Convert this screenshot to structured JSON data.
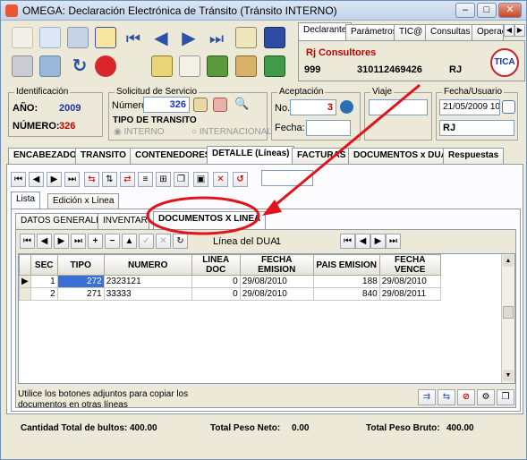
{
  "window": {
    "title": "OMEGA: Declaración Electrónica de Tránsito  (Tránsito INTERNO)"
  },
  "top_tabs": [
    "Declarante",
    "Parámetros",
    "TIC@",
    "Consultas",
    "Operac"
  ],
  "declarante": {
    "name": "Rj Consultores",
    "code": "999",
    "nit": "310112469426",
    "initials": "RJ"
  },
  "identificacion": {
    "label": "Identificación",
    "anio_label": "AÑO:",
    "anio": "2009",
    "numero_label": "NÚMERO:",
    "numero": "326"
  },
  "solicitud": {
    "label": "Solicitud de Servicio",
    "numero_label": "Número:",
    "numero": "326"
  },
  "tipo_transito": {
    "label": "TIPO DE TRANSITO",
    "interno": "INTERNO",
    "internacional": "INTERNACIONAL"
  },
  "aceptacion": {
    "label": "Aceptación",
    "no_label": "No.",
    "no": "3",
    "fecha_label": "Fecha:"
  },
  "viaje": {
    "label": "Viaje"
  },
  "fecha_usuario": {
    "label": "Fecha/Usuario",
    "fecha": "21/05/2009 10:",
    "usuario": "RJ"
  },
  "main_tabs": [
    "ENCABEZADO",
    "TRANSITO",
    "CONTENEDORES",
    "DETALLE (Líneas)",
    "FACTURAS",
    "DOCUMENTOS x DUA",
    "Respuestas"
  ],
  "sub_tabs": [
    "Lista",
    "Edición x Línea"
  ],
  "detail_tabs": [
    "DATOS GENERALES",
    "INVENTARIO",
    "DOCUMENTOS X LINEA"
  ],
  "linea_dua": {
    "label": "Línea del DUA:",
    "value": "1"
  },
  "grid": {
    "columns": [
      "SEC",
      "TIPO",
      "NUMERO",
      "LINEA DOC",
      "FECHA EMISION",
      "PAIS EMISION",
      "FECHA VENCE"
    ],
    "rows": [
      {
        "sec": "1",
        "tipo": "272",
        "numero": "2323121",
        "linea_doc": "0",
        "fecha_emision": "29/08/2010",
        "pais_emision": "188",
        "fecha_vence": "29/08/2010"
      },
      {
        "sec": "2",
        "tipo": "271",
        "numero": "33333",
        "linea_doc": "0",
        "fecha_emision": "29/08/2010",
        "pais_emision": "840",
        "fecha_vence": "29/08/2011"
      }
    ]
  },
  "hint": {
    "line1": "Utilice los botones adjuntos para copiar los",
    "line2": "documentos en otras líneas"
  },
  "totals": {
    "bultos_label": "Cantidad Total de bultos:",
    "bultos": "400.00",
    "neto_label": "Total Peso Neto:",
    "neto": "0.00",
    "bruto_label": "Total Peso Bruto:",
    "bruto": "400.00"
  },
  "colors": {
    "annotation": "#e0141c",
    "blue_values": "#1a33a8",
    "red_value": "#c00000"
  }
}
